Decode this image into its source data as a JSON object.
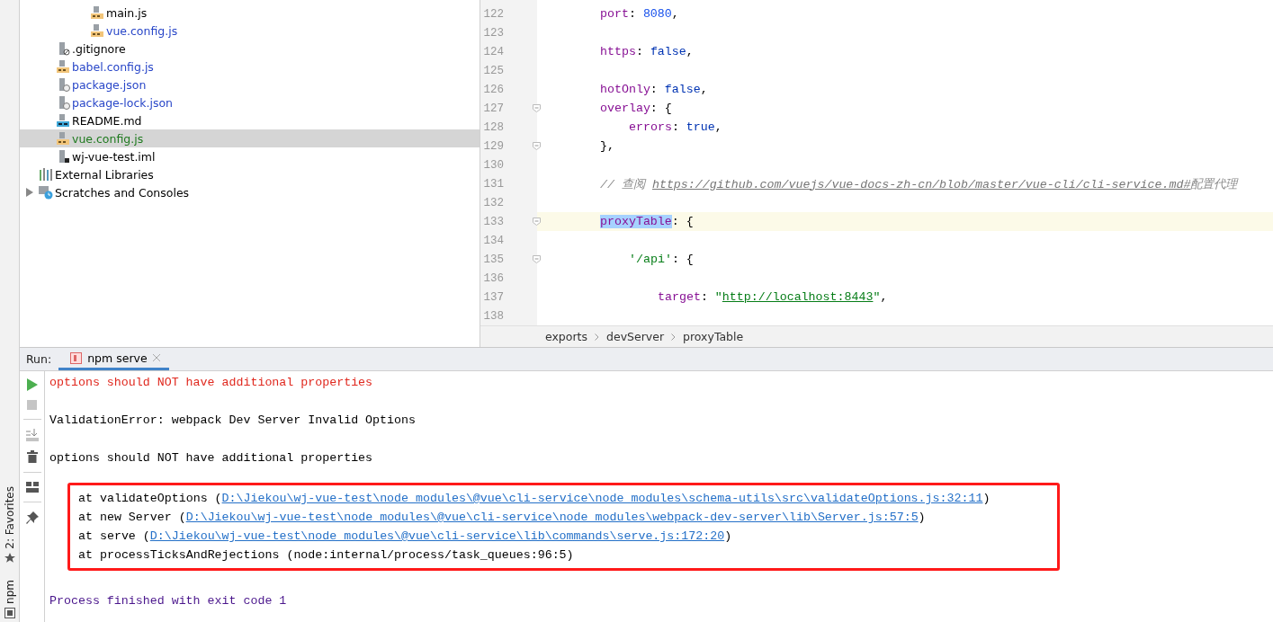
{
  "side_strip": {
    "tools": [
      {
        "label": "2: Favorites",
        "kind": "star"
      },
      {
        "label": "npm",
        "kind": "npm"
      }
    ]
  },
  "project_tree": {
    "nested_files": [
      {
        "name": "main.js",
        "kind": "js",
        "modified": false,
        "added": false,
        "selected": false
      },
      {
        "name": "vue.config.js",
        "kind": "js",
        "modified": true,
        "added": false,
        "selected": false
      }
    ],
    "files": [
      {
        "name": ".gitignore",
        "kind": "ignore",
        "modified": false,
        "added": false,
        "selected": false
      },
      {
        "name": "babel.config.js",
        "kind": "js",
        "modified": true,
        "added": false,
        "selected": false
      },
      {
        "name": "package.json",
        "kind": "json",
        "modified": true,
        "added": false,
        "selected": false
      },
      {
        "name": "package-lock.json",
        "kind": "json",
        "modified": true,
        "added": false,
        "selected": false
      },
      {
        "name": "README.md",
        "kind": "md",
        "modified": false,
        "added": false,
        "selected": false
      },
      {
        "name": "vue.config.js",
        "kind": "js",
        "modified": false,
        "added": true,
        "selected": true
      },
      {
        "name": "wj-vue-test.iml",
        "kind": "iml",
        "modified": false,
        "added": false,
        "selected": false
      }
    ],
    "roots": [
      {
        "name": "External Libraries",
        "kind": "libraries"
      },
      {
        "name": "Scratches and Consoles",
        "kind": "scratches",
        "expanded": false
      }
    ]
  },
  "editor": {
    "lines": [
      {
        "number": "122",
        "fold": false,
        "current": false,
        "segments": [
          {
            "kind": "key",
            "text": "port"
          },
          {
            "kind": "plain",
            "text": ": "
          },
          {
            "kind": "number",
            "text": "8080"
          },
          {
            "kind": "plain",
            "text": ","
          }
        ]
      },
      {
        "number": "123",
        "fold": false,
        "current": false
      },
      {
        "number": "124",
        "fold": false,
        "current": false,
        "segments": [
          {
            "kind": "key",
            "text": "https"
          },
          {
            "kind": "plain",
            "text": ": "
          },
          {
            "kind": "bool",
            "text": "false"
          },
          {
            "kind": "plain",
            "text": ","
          }
        ]
      },
      {
        "number": "125",
        "fold": false,
        "current": false
      },
      {
        "number": "126",
        "fold": false,
        "current": false,
        "segments": [
          {
            "kind": "key",
            "text": "hotOnly"
          },
          {
            "kind": "plain",
            "text": ": "
          },
          {
            "kind": "bool",
            "text": "false"
          },
          {
            "kind": "plain",
            "text": ","
          }
        ]
      },
      {
        "number": "127",
        "fold": true,
        "current": false,
        "segments": [
          {
            "kind": "key",
            "text": "overlay"
          },
          {
            "kind": "plain",
            "text": ": {"
          }
        ],
        "children": [
          {
            "number": "128",
            "fold": false,
            "current": false,
            "segments": [
              {
                "kind": "key",
                "text": "errors"
              },
              {
                "kind": "plain",
                "text": ": "
              },
              {
                "kind": "bool",
                "text": "true"
              },
              {
                "kind": "plain",
                "text": ","
              }
            ]
          }
        ]
      },
      {
        "number": "129",
        "fold": true,
        "current": false,
        "segments": [
          {
            "kind": "plain",
            "text": "},"
          }
        ]
      },
      {
        "number": "130",
        "fold": false,
        "current": false
      },
      {
        "number": "131",
        "fold": false,
        "current": false,
        "segments": [
          {
            "kind": "comment",
            "text": "// 查阅 "
          },
          {
            "kind": "comment_link",
            "text": "https://github.com/vuejs/vue-docs-zh-cn/blob/master/vue-cli/cli-service.md#"
          },
          {
            "kind": "comment",
            "text": "配置代理"
          }
        ]
      },
      {
        "number": "132",
        "fold": false,
        "current": false
      },
      {
        "number": "133",
        "fold": true,
        "current": true,
        "segments": [
          {
            "kind": "key_selected",
            "text": "proxyTable"
          },
          {
            "kind": "plain",
            "text": ": {"
          }
        ],
        "children": [
          {
            "number": "134",
            "fold": false,
            "current": false
          },
          {
            "number": "135",
            "fold": true,
            "current": false,
            "segments": [
              {
                "kind": "string",
                "text": "'/api'"
              },
              {
                "kind": "plain",
                "text": ": {"
              }
            ],
            "children": [
              {
                "number": "136",
                "fold": false,
                "current": false
              },
              {
                "number": "137",
                "fold": false,
                "current": false,
                "segments": [
                  {
                    "kind": "key",
                    "text": "target"
                  },
                  {
                    "kind": "plain",
                    "text": ": "
                  },
                  {
                    "kind": "string",
                    "text": "\""
                  },
                  {
                    "kind": "string_link",
                    "text": "http://localhost:8443"
                  },
                  {
                    "kind": "string",
                    "text": "\""
                  },
                  {
                    "kind": "plain",
                    "text": ","
                  }
                ]
              },
              {
                "number": "138",
                "fold": false,
                "current": false
              }
            ]
          }
        ]
      }
    ],
    "breadcrumbs": [
      "exports",
      "devServer",
      "proxyTable"
    ]
  },
  "run_panel": {
    "label": "Run:",
    "tabs": [
      {
        "label": "npm serve",
        "selected": true
      }
    ],
    "toolbar": [
      {
        "kind": "rerun",
        "disabled": false
      },
      {
        "kind": "stop",
        "disabled": true
      },
      {
        "kind": "scroll_end",
        "disabled": false
      },
      {
        "kind": "trash",
        "disabled": false
      },
      {
        "kind": "layout",
        "disabled": false
      },
      {
        "kind": "pin",
        "disabled": false
      }
    ],
    "console_before": [
      {
        "kind": "error",
        "text": "options should NOT have additional properties"
      },
      {
        "kind": "blank"
      },
      {
        "kind": "plain",
        "text": "ValidationError: webpack Dev Server Invalid Options"
      },
      {
        "kind": "blank"
      },
      {
        "kind": "plain",
        "text": "options should NOT have additional properties"
      }
    ],
    "stack_trace": [
      {
        "prefix": "at validateOptions (",
        "link": "D:\\Jiekou\\wj-vue-test\\node_modules\\@vue\\cli-service\\node_modules\\schema-utils\\src\\validateOptions.js:32:11",
        "suffix": ")"
      },
      {
        "prefix": "at new Server (",
        "link": "D:\\Jiekou\\wj-vue-test\\node_modules\\@vue\\cli-service\\node_modules\\webpack-dev-server\\lib\\Server.js:57:5",
        "suffix": ")"
      },
      {
        "prefix": "at serve (",
        "link": "D:\\Jiekou\\wj-vue-test\\node_modules\\@vue\\cli-service\\lib\\commands\\serve.js:172:20",
        "suffix": ")"
      },
      {
        "prefix": "at processTicksAndRejections (node:internal/process/task_queues:96:5)"
      }
    ],
    "console_after": [
      {
        "kind": "exit",
        "text": "Process finished with exit code 1"
      }
    ]
  }
}
